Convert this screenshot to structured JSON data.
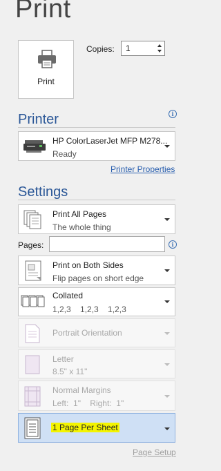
{
  "title": "Print",
  "print_button": {
    "label": "Print",
    "icon": "printer-icon"
  },
  "copies": {
    "label": "Copies:",
    "value": "1"
  },
  "printer": {
    "heading": "Printer",
    "name": "HP ColorLaserJet MFP M278...",
    "status": "Ready",
    "properties_link": "Printer Properties"
  },
  "settings": {
    "heading": "Settings",
    "pages_label": "Pages:",
    "pages_value": "",
    "items": [
      {
        "title": "Print All Pages",
        "subtitle": "The whole thing",
        "state": "enabled"
      },
      {
        "title": "Print on Both Sides",
        "subtitle": "Flip pages on short edge",
        "state": "enabled"
      },
      {
        "title": "Collated",
        "subtitle": "1,2,3    1,2,3    1,2,3",
        "state": "enabled"
      },
      {
        "title": "Portrait Orientation",
        "subtitle": "",
        "state": "disabled"
      },
      {
        "title": "Letter",
        "subtitle": "8.5\" x 11\"",
        "state": "disabled"
      },
      {
        "title": "Normal Margins",
        "subtitle": "Left:  1\"    Right:  1\"",
        "state": "disabled"
      },
      {
        "title": "1 Page Per Sheet",
        "subtitle": "",
        "state": "selected"
      }
    ],
    "page_setup_link": "Page Setup"
  },
  "colors": {
    "heading": "#2b5797",
    "link": "#2a5fae",
    "highlight": "#f4f400",
    "selected_bg": "#cfe0f5"
  }
}
